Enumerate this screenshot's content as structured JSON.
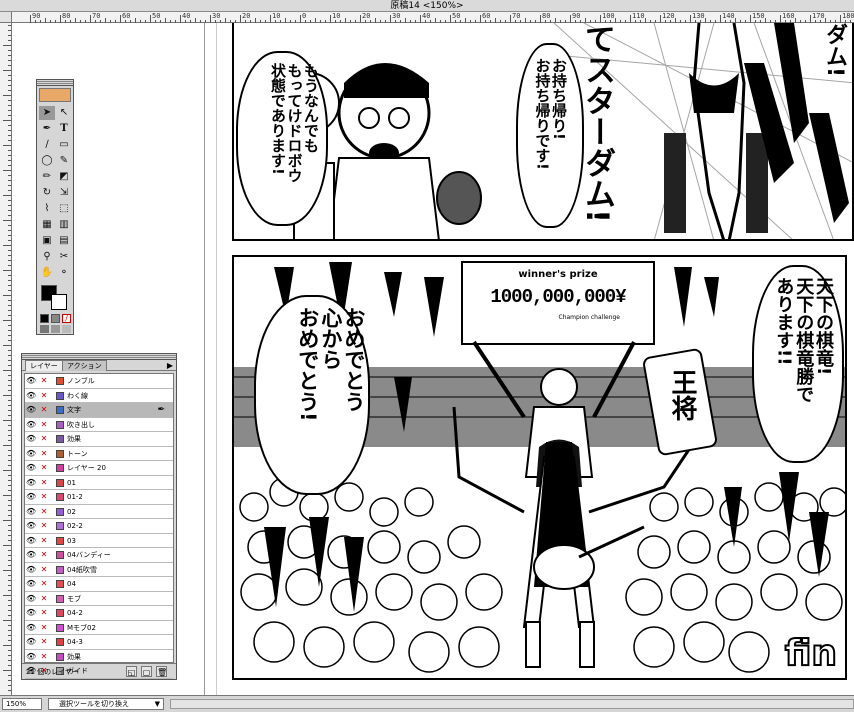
{
  "window": {
    "title": "原稿14 <150%>"
  },
  "ruler": {
    "ticks": [
      "90",
      "80",
      "70",
      "60",
      "50",
      "40",
      "30",
      "20",
      "10",
      "0",
      "10",
      "20",
      "30",
      "40",
      "50",
      "60",
      "70",
      "80",
      "90",
      "100",
      "110",
      "120",
      "130",
      "140",
      "150",
      "160",
      "170",
      "180"
    ]
  },
  "manga": {
    "panel1": {
      "bubble_left": "もうなんでも\nもってけドロボウ\n状態であります!",
      "bubble_middle": "お持ち帰り!\nお持ち帰りです!",
      "caption_big": "てスターダム!",
      "caption_right": "ダム!"
    },
    "panel2": {
      "prize_header": "winner's prize",
      "prize_amount": "1000,000,000¥",
      "prize_sub": "Champion challenge",
      "bubble_left": "おめでとう\n心から\nおめでとう!",
      "sign": "王将",
      "bubble_right": "天下の棋竜!\n天下の棋竜勝で\nあります!!",
      "fin": "fin"
    }
  },
  "layers_panel": {
    "tabs": [
      "レイヤー",
      "アクション"
    ],
    "layers": [
      {
        "name": "ノンブル",
        "color": "#e05030"
      },
      {
        "name": "わく線",
        "color": "#6a56c8"
      },
      {
        "name": "文字",
        "color": "#3a6cc8",
        "selected": true
      },
      {
        "name": "吹き出し",
        "color": "#a860c0"
      },
      {
        "name": "効果",
        "color": "#7a5aa0"
      },
      {
        "name": "トーン",
        "color": "#b06030"
      },
      {
        "name": "レイヤー 20",
        "color": "#d040a0"
      },
      {
        "name": "01",
        "color": "#d84848"
      },
      {
        "name": "01-2",
        "color": "#d84870"
      },
      {
        "name": "02",
        "color": "#9060d0"
      },
      {
        "name": "02-2",
        "color": "#b070d8"
      },
      {
        "name": "03",
        "color": "#e04848"
      },
      {
        "name": "04バンディー",
        "color": "#d050a0"
      },
      {
        "name": "04紙吹雪",
        "color": "#c060c0"
      },
      {
        "name": "04",
        "color": "#e05050"
      },
      {
        "name": "モブ",
        "color": "#d060b0"
      },
      {
        "name": "04-2",
        "color": "#e04860"
      },
      {
        "name": "Mモブ02",
        "color": "#d050d0"
      },
      {
        "name": "04-3",
        "color": "#e04040"
      },
      {
        "name": "効果",
        "color": "#c050c0"
      },
      {
        "name": "ガイド",
        "color": "#a0a0a0"
      }
    ],
    "count_label": "21 個のレイヤー"
  },
  "status": {
    "zoom": "150%",
    "tool": "選択ツールを切り換え"
  }
}
